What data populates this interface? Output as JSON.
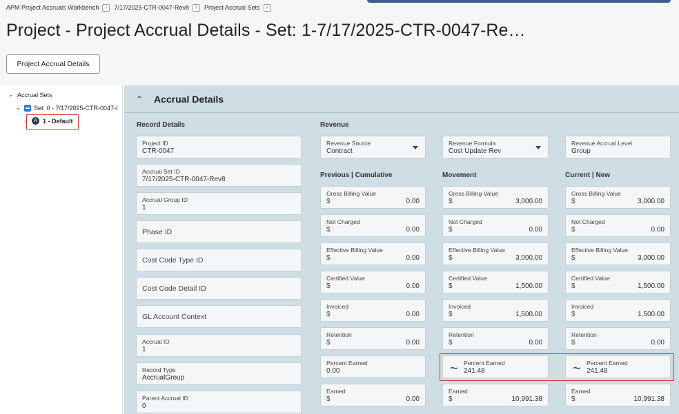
{
  "breadcrumb": [
    "APM Project Accruals Workbench",
    "7/17/2025-CTR-0047-Rev8",
    "Project Accrual Sets"
  ],
  "page_title": "Project - Project Accrual Details - Set: 1-7/17/2025-CTR-0047-Re…",
  "tab_button": "Project Accrual Details",
  "tree": {
    "root": "Accrual Sets",
    "set": "Set: 0 - 7/17/2025-CTR-0047-I",
    "default_icon": "A",
    "default": "1 - Default"
  },
  "panel": {
    "title": "Accrual Details",
    "record_details_label": "Record Details",
    "revenue_label": "Revenue",
    "previous_label": "Previous | Cumulative",
    "movement_label": "Movement",
    "current_label": "Current | New"
  },
  "record": {
    "project_id": {
      "label": "Project ID",
      "value": "CTR-0047"
    },
    "accrual_set_id": {
      "label": "Accrual Set ID",
      "value": "7/17/2025-CTR-0047-Rev8"
    },
    "accrual_group_id": {
      "label": "Accrual Group ID",
      "value": "1"
    },
    "phase_id": {
      "label": "Phase ID"
    },
    "cost_code_type_id": {
      "label": "Cost Code Type ID"
    },
    "cost_code_detail_id": {
      "label": "Cost Code Detail ID"
    },
    "gl_account_context": {
      "label": "GL Account Context"
    },
    "accrual_id": {
      "label": "Accrual ID",
      "value": "1"
    },
    "record_type": {
      "label": "Record Type",
      "value": "AccrualGroup"
    },
    "parent_accrual_id": {
      "label": "Parent Accrual ID",
      "value": "0"
    }
  },
  "revenue": {
    "source": {
      "label": "Revenue Source",
      "value": "Contract"
    },
    "formula": {
      "label": "Revenue Formula",
      "value": "Cost Update Rev"
    },
    "level": {
      "label": "Revenue Accrual Level",
      "value": "Group"
    }
  },
  "currency": "$",
  "previous": {
    "gross": {
      "label": "Gross Billing Value",
      "value": "0.00"
    },
    "not_charged": {
      "label": "Not Charged",
      "value": "0.00"
    },
    "effective": {
      "label": "Effective Billing Value",
      "value": "0.00"
    },
    "certified": {
      "label": "Certified Value",
      "value": "0.00"
    },
    "invoiced": {
      "label": "Invoiced",
      "value": "0.00"
    },
    "retention": {
      "label": "Retention",
      "value": "0.00"
    },
    "percent_earned": {
      "label": "Percent Earned",
      "value": "0.00"
    },
    "earned": {
      "label": "Earned",
      "value": "0.00"
    }
  },
  "movement": {
    "gross": {
      "label": "Gross Billing Value",
      "value": "3,000.00"
    },
    "not_charged": {
      "label": "Not Charged",
      "value": "0.00"
    },
    "effective": {
      "label": "Effective Billing Value",
      "value": "3,000.00"
    },
    "certified": {
      "label": "Certified Value",
      "value": "1,500.00"
    },
    "invoiced": {
      "label": "Invoiced",
      "value": "1,500.00"
    },
    "retention": {
      "label": "Retention",
      "value": "0.00"
    },
    "percent_earned": {
      "label": "Percent Earned",
      "value": "241.48"
    },
    "earned": {
      "label": "Earned",
      "value": "10,991.38"
    }
  },
  "current": {
    "gross": {
      "label": "Gross Billing Value",
      "value": "3,000.00"
    },
    "not_charged": {
      "label": "Not Charged",
      "value": "0.00"
    },
    "effective": {
      "label": "Effective Billing Value",
      "value": "3,000.00"
    },
    "certified": {
      "label": "Certified Value",
      "value": "1,500.00"
    },
    "invoiced": {
      "label": "Invoiced",
      "value": "1,500.00"
    },
    "retention": {
      "label": "Retention",
      "value": "0.00"
    },
    "percent_earned": {
      "label": "Percent Earned",
      "value": "241.48"
    },
    "earned": {
      "label": "Earned",
      "value": "10,991.38"
    }
  },
  "colors": {
    "highlight": "#d43a3a",
    "panel_bg": "#cfdde5",
    "set_icon": "#2f7bd3"
  },
  "icons": [
    "breadcrumb-chevron-icon",
    "chevron-down-icon",
    "chevron-right-icon",
    "chevron-up-icon",
    "set-icon",
    "default-circle-icon",
    "dropdown-caret-icon",
    "tilde-calculated-icon"
  ]
}
